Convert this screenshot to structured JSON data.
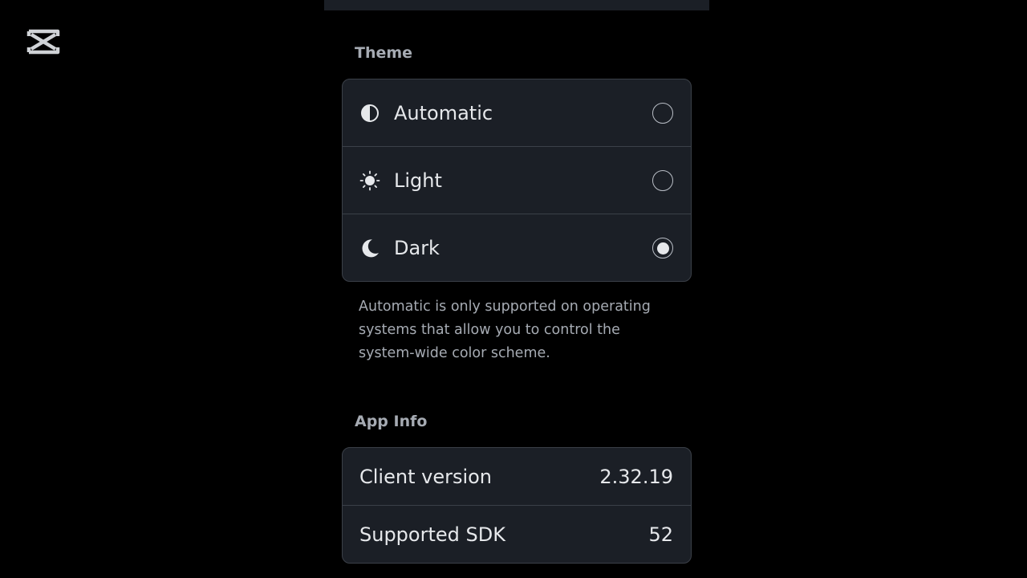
{
  "logo": {
    "icon": "capcut-logo-icon",
    "color": "#cfd2d6"
  },
  "theme_section": {
    "title": "Theme",
    "options": [
      {
        "label": "Automatic",
        "icon": "half-circle-icon",
        "selected": false
      },
      {
        "label": "Light",
        "icon": "sun-icon",
        "selected": false
      },
      {
        "label": "Dark",
        "icon": "moon-icon",
        "selected": true
      }
    ],
    "note": "Automatic is only supported on operating systems that allow you to control the system-wide color scheme."
  },
  "app_info_section": {
    "title": "App Info",
    "rows": [
      {
        "label": "Client version",
        "value": "2.32.19"
      },
      {
        "label": "Supported SDK",
        "value": "52"
      }
    ]
  },
  "colors": {
    "background": "#000000",
    "card": "#1b1f26",
    "border": "#3b4048",
    "text": "#e6e8eb",
    "muted": "#a6abb3"
  }
}
